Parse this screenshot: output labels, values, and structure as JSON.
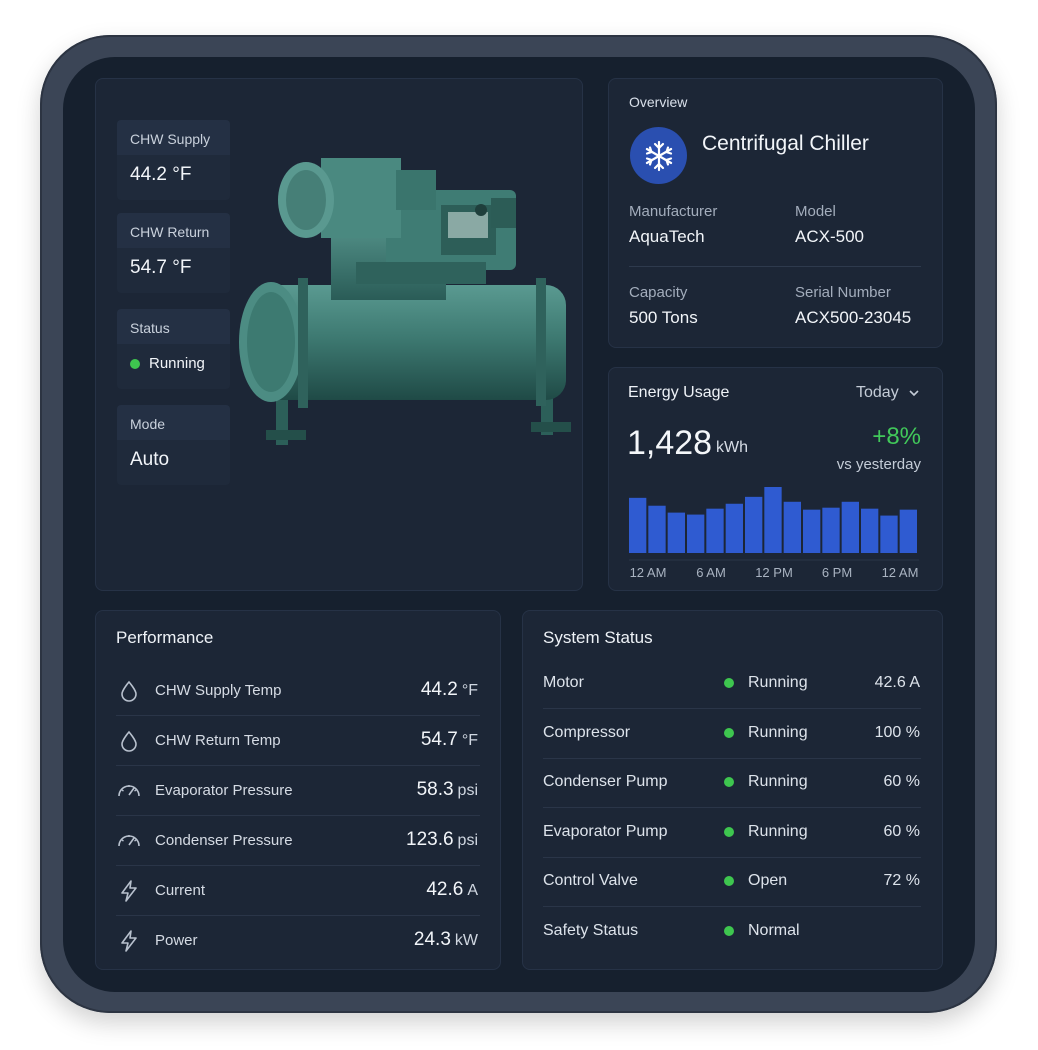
{
  "hero": {
    "tiles": [
      {
        "label": "CHW Supply",
        "value": "44.2 °F"
      },
      {
        "label": "CHW Return",
        "value": "54.7 °F"
      },
      {
        "label": "Status",
        "value": "Running"
      },
      {
        "label": "Mode",
        "value": "Auto"
      }
    ]
  },
  "overview": {
    "title": "Overview",
    "icon": "snowflake-icon",
    "name": "Centrifugal Chiller",
    "manufacturer_label": "Manufacturer",
    "manufacturer": "AquaTech",
    "model_label": "Model",
    "model": "ACX-500",
    "capacity_label": "Capacity",
    "capacity": "500 Tons",
    "serial_label": "Serial Number",
    "serial": "ACX500-23045"
  },
  "energy": {
    "title": "Energy Usage",
    "period": "Today",
    "value": "1,428",
    "unit": "kWh",
    "change": "+8%",
    "change_sub": "vs yesterday",
    "accent": "#41c85a"
  },
  "chart_data": {
    "type": "bar",
    "values": [
      56,
      48,
      41,
      39,
      45,
      50,
      57,
      67,
      52,
      44,
      46,
      52,
      45,
      38,
      44
    ],
    "x_ticks": [
      "12 AM",
      "6 AM",
      "12 PM",
      "6 PM",
      "12 AM"
    ],
    "color": "#2f5bd1"
  },
  "performance": {
    "title": "Performance",
    "rows": [
      {
        "icon": "droplet-icon",
        "label": "CHW Supply Temp",
        "value": "44.2",
        "unit": "°F"
      },
      {
        "icon": "droplet-icon",
        "label": "CHW Return Temp",
        "value": "54.7",
        "unit": "°F"
      },
      {
        "icon": "gauge-icon",
        "label": "Evaporator Pressure",
        "value": "58.3",
        "unit": "psi"
      },
      {
        "icon": "gauge-icon",
        "label": "Condenser Pressure",
        "value": "123.6",
        "unit": "psi"
      },
      {
        "icon": "bolt-icon",
        "label": "Current",
        "value": "42.6",
        "unit": "A"
      },
      {
        "icon": "bolt-icon",
        "label": "Power",
        "value": "24.3",
        "unit": "kW"
      }
    ]
  },
  "system_status": {
    "title": "System Status",
    "status_color": "#3ec64f",
    "rows": [
      {
        "label": "Motor",
        "status": "Running",
        "value": "42.6 A"
      },
      {
        "label": "Compressor",
        "status": "Running",
        "value": "100 %"
      },
      {
        "label": "Condenser Pump",
        "status": "Running",
        "value": "60 %"
      },
      {
        "label": "Evaporator Pump",
        "status": "Running",
        "value": "60 %"
      },
      {
        "label": "Control Valve",
        "status": "Open",
        "value": "72 %"
      },
      {
        "label": "Safety Status",
        "status": "Normal",
        "value": ""
      }
    ]
  }
}
